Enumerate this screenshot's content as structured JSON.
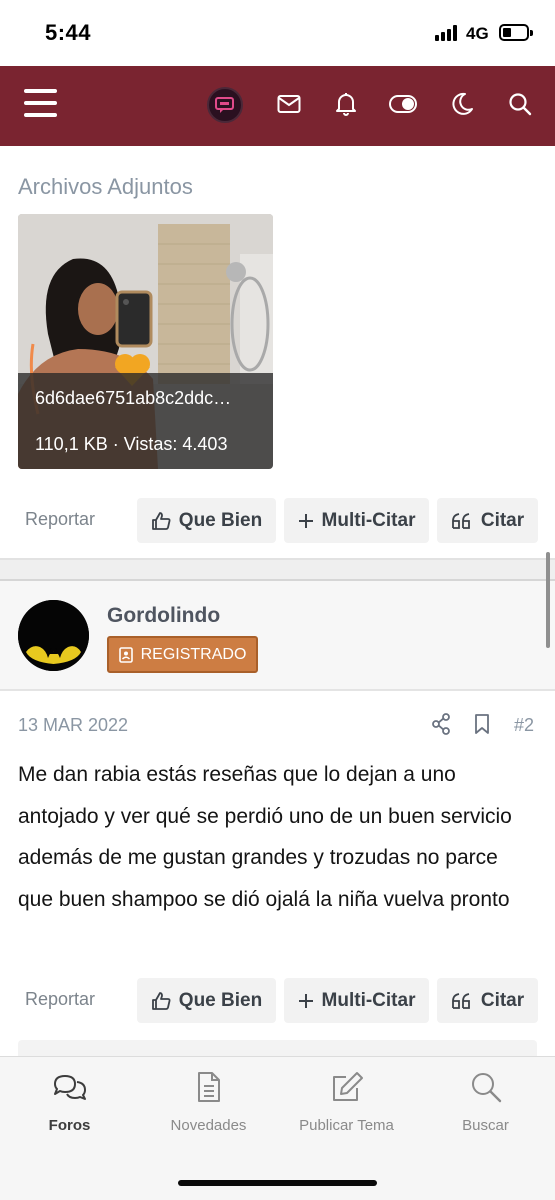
{
  "status_bar": {
    "time": "5:44",
    "network": "4G"
  },
  "topnav": {
    "icons": [
      "menu-icon",
      "site-logo",
      "mail-icon",
      "bell-icon",
      "toggle-icon",
      "moon-icon",
      "search-icon"
    ],
    "accent": "#7a2430"
  },
  "attachments": {
    "title": "Archivos Adjuntos",
    "file_name": "6d6dae6751ab8c2ddc…",
    "file_meta": "110,1 KB · Vistas: 4.403"
  },
  "actions_1": {
    "report": "Reportar",
    "like": "Que Bien",
    "multiquote": "Multi-Citar",
    "quote": "Citar"
  },
  "post": {
    "author": "Gordolindo",
    "role": "REGISTRADO",
    "role_color": "#cd7d43",
    "date": "13 MAR 2022",
    "number": "#2",
    "body": "Me dan rabia estás reseñas que lo dejan a uno antojado y ver qué se perdió uno de un buen servicio además de me gustan grandes y trozudas no parce que buen shampoo se dió ojalá la niña vuelva pronto"
  },
  "actions_2": {
    "report": "Reportar",
    "like": "Que Bien",
    "multiquote": "Multi-Citar",
    "quote": "Citar"
  },
  "tabbar": {
    "tabs": [
      {
        "label": "Foros",
        "icon": "chat-bubbles-icon",
        "active": true
      },
      {
        "label": "Novedades",
        "icon": "document-icon",
        "active": false
      },
      {
        "label": "Publicar Tema",
        "icon": "edit-icon",
        "active": false
      },
      {
        "label": "Buscar",
        "icon": "search-icon",
        "active": false
      }
    ]
  }
}
